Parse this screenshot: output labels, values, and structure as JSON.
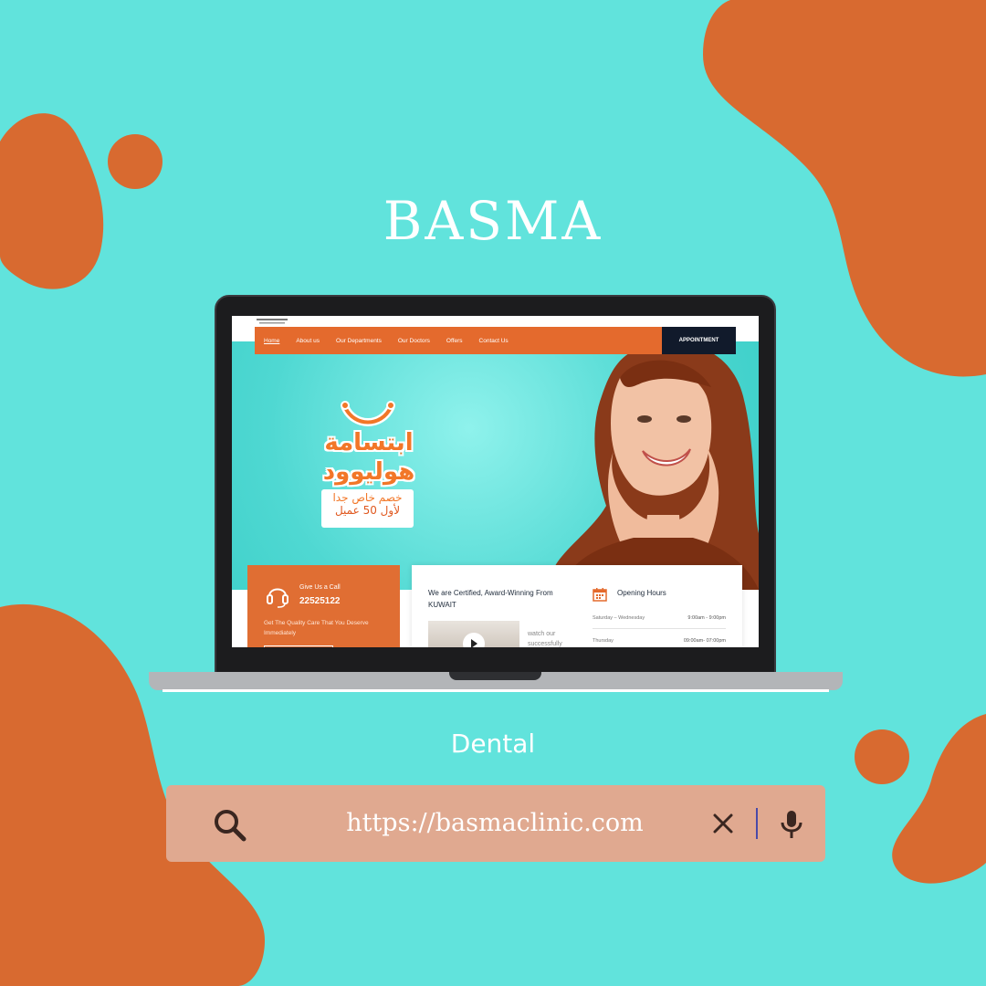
{
  "colors": {
    "background": "#61e3dc",
    "blob": "#d86a30",
    "accent_orange": "#e46a2d",
    "nav_dark": "#111a2b",
    "search_bar": "#e0a990"
  },
  "header": {
    "title": "BASMA",
    "subtitle": "Dental"
  },
  "site": {
    "nav": {
      "items": [
        "Home",
        "About us",
        "Our Departments",
        "Our Doctors",
        "Offers",
        "Contact Us"
      ],
      "active": "Home",
      "appointment_label": "APPOINTMENT"
    },
    "promo": {
      "line1": "ابتسامة",
      "line2": "هوليوود",
      "box_line1": "خصم خاص جدا",
      "box_line2": "لأول 50 عميل"
    },
    "call_card": {
      "label": "Give Us a Call",
      "number": "22525122",
      "description": "Get The Quality Care That You Deserve Immediately"
    },
    "info_card": {
      "certified": "We are Certified, Award-Winning From KUWAIT",
      "watch_text": "watch our successfully",
      "hours_title": "Opening Hours",
      "hours": [
        {
          "day": "Saturday – Wednesday",
          "time": "9:00am - 9:00pm"
        },
        {
          "day": "Thursday",
          "time": "09:00am- 07:00pm"
        }
      ]
    }
  },
  "search": {
    "url": "https://basmaclinic.com",
    "icons": [
      "search-icon",
      "close-icon",
      "microphone-icon"
    ]
  }
}
